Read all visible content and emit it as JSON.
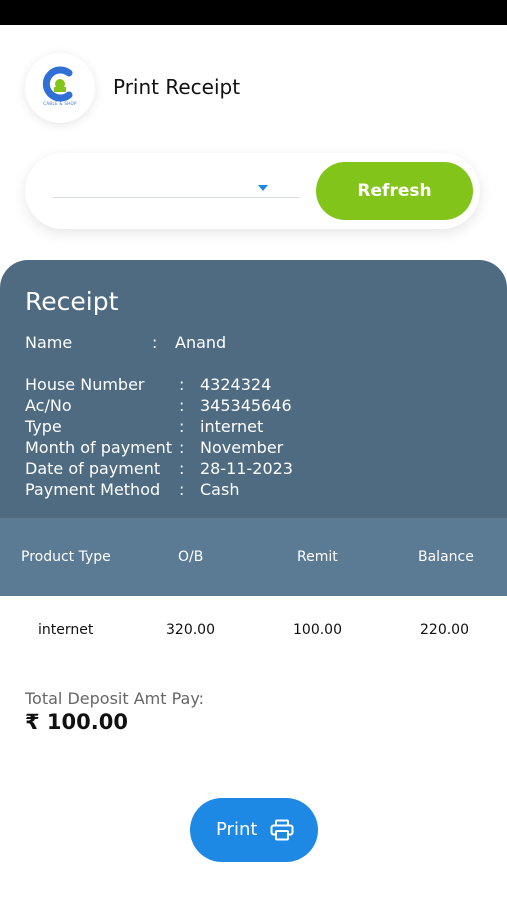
{
  "header": {
    "title": "Print Receipt",
    "logo_caption": "CABLE & SHOP"
  },
  "filter": {
    "dropdown_value": "",
    "refresh_label": "Refresh"
  },
  "receipt": {
    "title": "Receipt",
    "name_label": "Name",
    "name_value": "Anand",
    "fields": [
      {
        "label": "House Number",
        "value": "4324324"
      },
      {
        "label": "Ac/No",
        "value": "345345646"
      },
      {
        "label": "Type",
        "value": "internet"
      },
      {
        "label": "Month of payment",
        "value": "November"
      },
      {
        "label": "Date of payment",
        "value": "28-11-2023"
      },
      {
        "label": "Payment Method",
        "value": "Cash"
      }
    ],
    "separator": ":"
  },
  "table": {
    "headers": [
      "Product Type",
      "O/B",
      "Remit",
      "Balance"
    ],
    "rows": [
      [
        "internet",
        "320.00",
        "100.00",
        "220.00"
      ]
    ]
  },
  "deposit": {
    "label": "Total Deposit Amt  Pay:",
    "amount": "₹ 100.00"
  },
  "print": {
    "label": "Print"
  },
  "colors": {
    "panel": "#4e6b82",
    "table_head": "#5b7b95",
    "refresh": "#82c41a",
    "print": "#1e88e5"
  }
}
